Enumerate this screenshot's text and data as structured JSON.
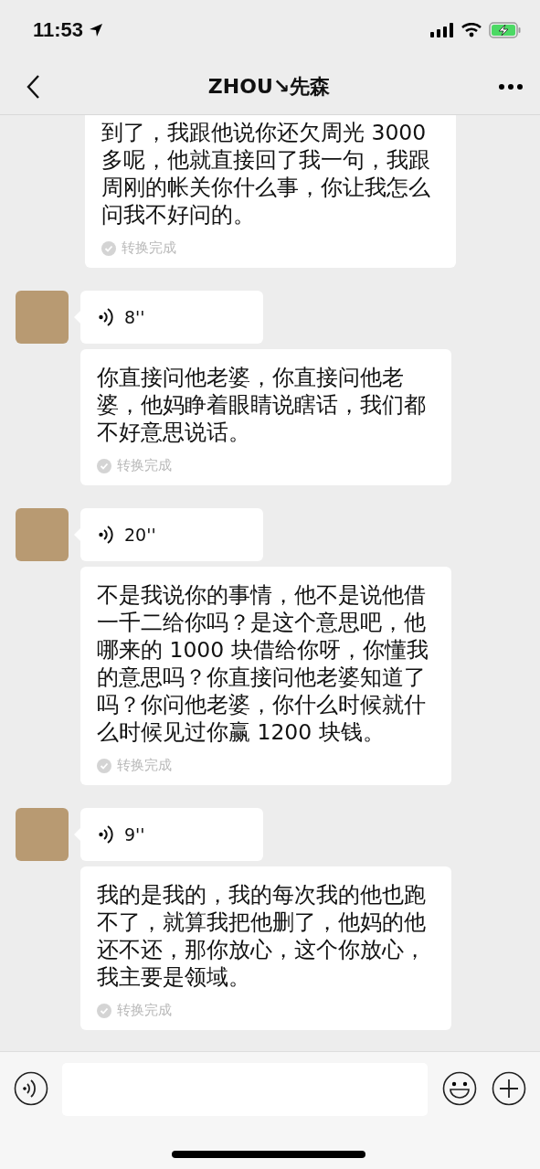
{
  "status_bar": {
    "time": "11:53"
  },
  "nav": {
    "title": "ZHOU↘先森"
  },
  "top_transcript": {
    "text": "到了，我跟他说你还欠周光 3000 多呢，他就直接回了我一句，我跟周刚的帐关你什么事，你让我怎么问我不好问的。",
    "status": "转换完成"
  },
  "messages": [
    {
      "duration": "8''",
      "transcript": "你直接问他老婆，你直接问他老婆，他妈睁着眼睛说瞎话，我们都不好意思说话。",
      "status": "转换完成"
    },
    {
      "duration": "20''",
      "transcript": "不是我说你的事情，他不是说他借一千二给你吗？是这个意思吧，他哪来的 1000 块借给你呀，你懂我的意思吗？你直接问他老婆知道了吗？你问他老婆，你什么时候就什么时候见过你赢 1200 块钱。",
      "status": "转换完成"
    },
    {
      "duration": "9''",
      "transcript": "我的是我的，我的每次我的他也跑不了，就算我把他删了，他妈的他还不还，那你放心，这个你放心，我主要是领域。",
      "status": "转换完成"
    }
  ]
}
